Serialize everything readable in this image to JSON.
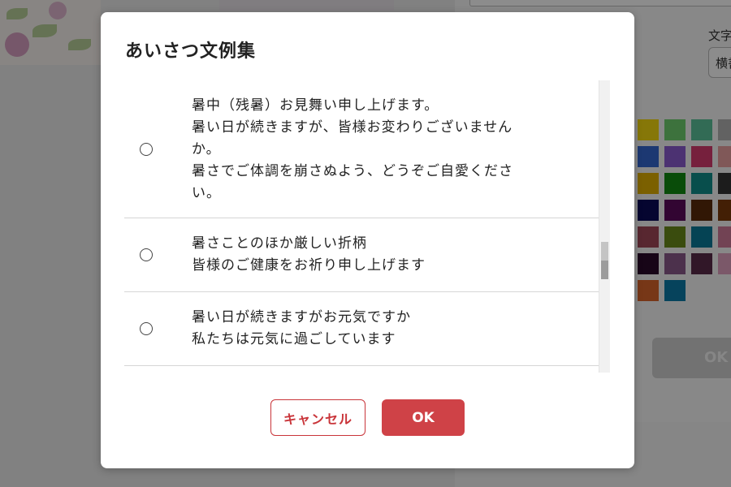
{
  "background": {
    "label": "文字",
    "select_value": "横書",
    "ok_label": "OK",
    "swatches": [
      "#f5d90f",
      "#6fd06f",
      "#5bc39b",
      "#b3b3b3",
      "#d8d8d8",
      "#3467d0",
      "#8a5bd0",
      "#d83b6f",
      "#e9a0a0",
      "#f0c0c0",
      "#e0b000",
      "#118a11",
      "#0f8f8a",
      "#333333",
      "#c0c0c0",
      "#0a0a58",
      "#5c0a5c",
      "#5a2a0a",
      "#7a3a0a",
      "#a06030",
      "#a04858",
      "#6a8a1a",
      "#0a7a9a",
      "#d07a9a",
      "#e0a0b0",
      "#2a0a2a",
      "#8a5a8a",
      "#5a2a4a",
      "#e0a0c0",
      "#f0c0d0",
      "#d9652a",
      "#0c7aa8"
    ]
  },
  "modal": {
    "title": "あいさつ文例集",
    "items": [
      {
        "lines": [
          "暑中（残暑）お見舞い申し上げます。",
          "暑い日が続きますが、皆様お変わりございません",
          "か。",
          "暑さでご体調を崩さぬよう、どうぞご自愛くださ",
          "い。"
        ]
      },
      {
        "lines": [
          "暑さことのほか厳しい折柄",
          "皆様のご健康をお祈り申し上げます"
        ]
      },
      {
        "lines": [
          "暑い日が続きますがお元気ですか",
          "私たちは元気に過ごしています"
        ]
      }
    ],
    "cancel_label": "キャンセル",
    "ok_label": "OK"
  },
  "colors": {
    "accent": "#cf4247",
    "overlay": "rgba(0,0,0,0.45)"
  }
}
